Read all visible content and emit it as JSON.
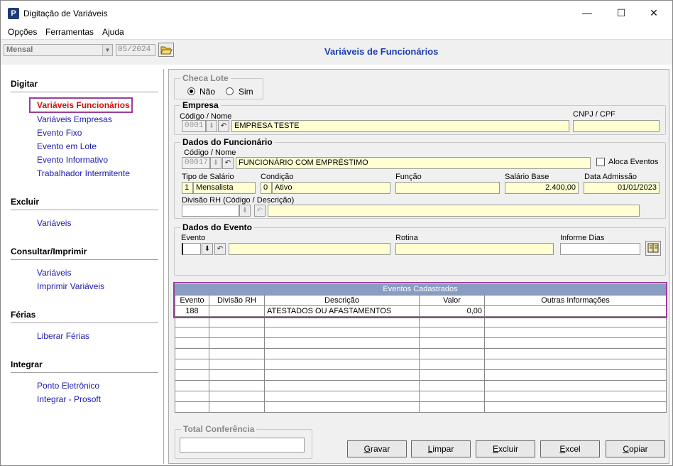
{
  "window": {
    "title": "Digitação de Variáveis",
    "min": "—",
    "max": "☐",
    "close": "✕"
  },
  "menu": [
    "Opções",
    "Ferramentas",
    "Ajuda"
  ],
  "toolbar": {
    "period": "Mensal",
    "date": "05/2024"
  },
  "page_title": "Variáveis de Funcionários",
  "sidebar": {
    "digitar": {
      "title": "Digitar",
      "items": [
        "Variáveis Funcionários",
        "Variáveis Empresas",
        "Evento Fixo",
        "Evento em Lote",
        "Evento Informativo",
        "Trabalhador Intermitente"
      ]
    },
    "excluir": {
      "title": "Excluir",
      "items": [
        "Variáveis"
      ]
    },
    "consultar": {
      "title": "Consultar/Imprimir",
      "items": [
        "Variáveis",
        "Imprimir Variáveis"
      ]
    },
    "ferias": {
      "title": "Férias",
      "items": [
        "Liberar Férias"
      ]
    },
    "integrar": {
      "title": "Integrar",
      "items": [
        "Ponto Eletrônico",
        "Integrar - Prosoft"
      ]
    }
  },
  "checa_lote": {
    "title": "Checa Lote",
    "nao": "Não",
    "sim": "Sim"
  },
  "empresa": {
    "title": "Empresa",
    "codigo_label": "Código / Nome",
    "codigo": "0001",
    "nome": "EMPRESA TESTE",
    "cnpj_label": "CNPJ / CPF",
    "cnpj": ""
  },
  "funcionario": {
    "title": "Dados do Funcionário",
    "codigo_label": "Código / Nome",
    "codigo": "00017",
    "nome": "FUNCIONÁRIO COM EMPRÉSTIMO",
    "aloca_label": "Aloca Eventos",
    "tipo_salario_label": "Tipo de Salário",
    "tipo_salario_cod": "1",
    "tipo_salario": "Mensalista",
    "condicao_label": "Condição",
    "condicao_cod": "0",
    "condicao": "Ativo",
    "funcao_label": "Função",
    "funcao": "",
    "salario_label": "Salário Base",
    "salario": "2.400,00",
    "admissao_label": "Data Admissão",
    "admissao": "01/01/2023",
    "divisao_label": "Divisão RH (Código / Descrição)"
  },
  "evento": {
    "title": "Dados do Evento",
    "evento_label": "Evento",
    "rotina_label": "Rotina",
    "informe_label": "Informe Dias"
  },
  "grid": {
    "title": "Eventos Cadastrados",
    "columns": [
      "Evento",
      "Divisão RH",
      "Descrição",
      "Valor",
      "Outras Informações"
    ],
    "rows": [
      [
        "188",
        "",
        "ATESTADOS OU AFASTAMENTOS",
        "0,00",
        ""
      ]
    ]
  },
  "total": {
    "title": "Total Conferência"
  },
  "buttons": {
    "gravar": [
      "G",
      "ravar"
    ],
    "limpar": [
      "L",
      "impar"
    ],
    "excluir": [
      "E",
      "xcluir"
    ],
    "excel": [
      "E",
      "xcel"
    ],
    "copiar": [
      "C",
      "opiar"
    ]
  }
}
